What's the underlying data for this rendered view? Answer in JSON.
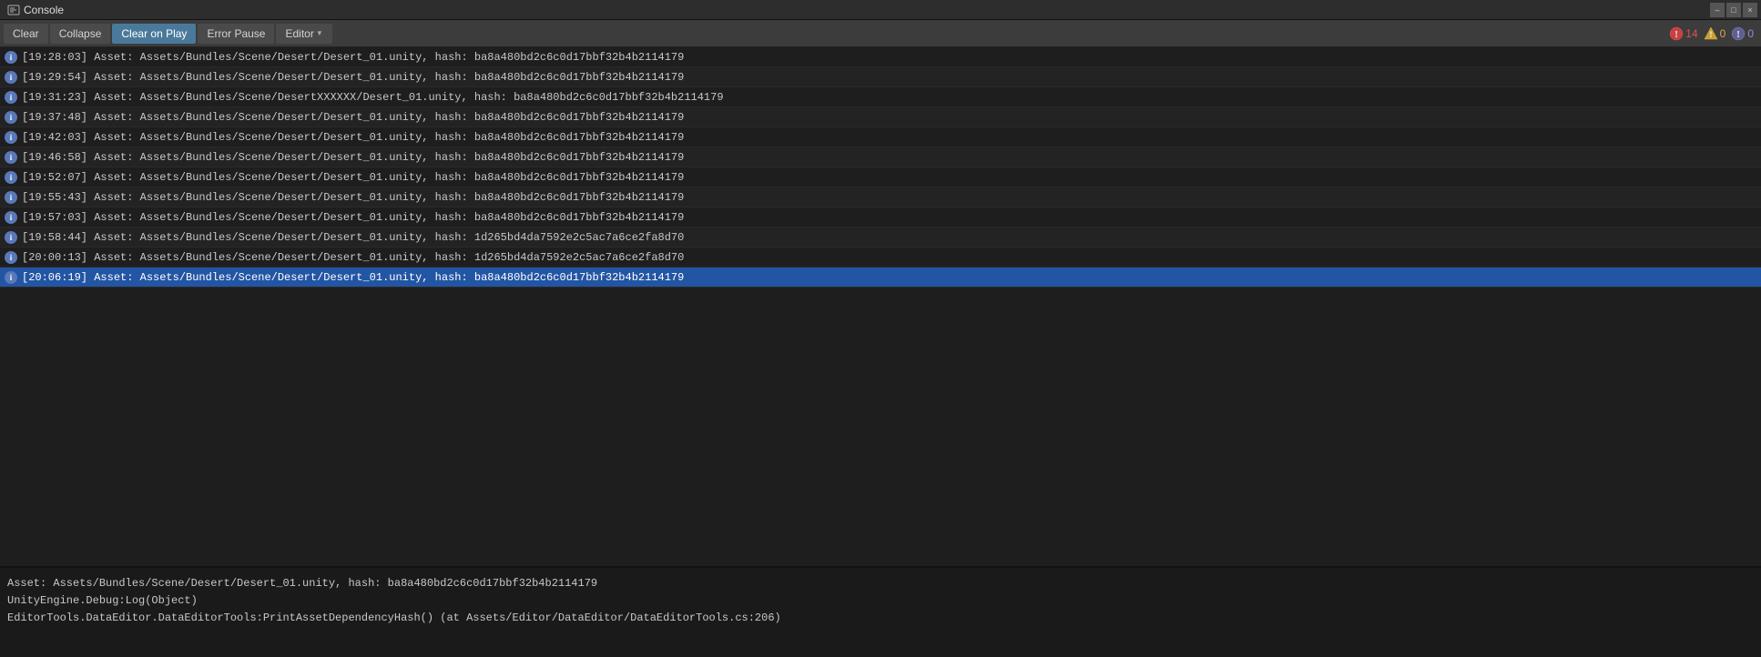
{
  "window": {
    "title": "Console",
    "icon": "console-icon"
  },
  "titlebar": {
    "controls": {
      "minimize": "–",
      "restore": "□",
      "close": "×"
    }
  },
  "toolbar": {
    "clear_label": "Clear",
    "collapse_label": "Collapse",
    "clear_on_play_label": "Clear on Play",
    "error_pause_label": "Error Pause",
    "editor_label": "Editor",
    "badge_errors_count": "14",
    "badge_warnings_count": "0",
    "badge_info_count": "0"
  },
  "log_rows": [
    {
      "time": "[19:28:03]",
      "message": "Asset: Assets/Bundles/Scene/Desert/Desert_01.unity, hash: ba8a480bd2c6c0d17bbf32b4b2114179",
      "selected": false
    },
    {
      "time": "[19:29:54]",
      "message": "Asset: Assets/Bundles/Scene/Desert/Desert_01.unity, hash: ba8a480bd2c6c0d17bbf32b4b2114179",
      "selected": false
    },
    {
      "time": "[19:31:23]",
      "message": "Asset: Assets/Bundles/Scene/DesertXXXXXX/Desert_01.unity, hash: ba8a480bd2c6c0d17bbf32b4b2114179",
      "selected": false
    },
    {
      "time": "[19:37:48]",
      "message": "Asset: Assets/Bundles/Scene/Desert/Desert_01.unity, hash: ba8a480bd2c6c0d17bbf32b4b2114179",
      "selected": false
    },
    {
      "time": "[19:42:03]",
      "message": "Asset: Assets/Bundles/Scene/Desert/Desert_01.unity, hash: ba8a480bd2c6c0d17bbf32b4b2114179",
      "selected": false
    },
    {
      "time": "[19:46:58]",
      "message": "Asset: Assets/Bundles/Scene/Desert/Desert_01.unity, hash: ba8a480bd2c6c0d17bbf32b4b2114179",
      "selected": false
    },
    {
      "time": "[19:52:07]",
      "message": "Asset: Assets/Bundles/Scene/Desert/Desert_01.unity, hash: ba8a480bd2c6c0d17bbf32b4b2114179",
      "selected": false
    },
    {
      "time": "[19:55:43]",
      "message": "Asset: Assets/Bundles/Scene/Desert/Desert_01.unity, hash: ba8a480bd2c6c0d17bbf32b4b2114179",
      "selected": false
    },
    {
      "time": "[19:57:03]",
      "message": "Asset: Assets/Bundles/Scene/Desert/Desert_01.unity, hash: ba8a480bd2c6c0d17bbf32b4b2114179",
      "selected": false
    },
    {
      "time": "[19:58:44]",
      "message": "Asset: Assets/Bundles/Scene/Desert/Desert_01.unity, hash: 1d265bd4da7592e2c5ac7a6ce2fa8d70",
      "selected": false
    },
    {
      "time": "[20:00:13]",
      "message": "Asset: Assets/Bundles/Scene/Desert/Desert_01.unity, hash: 1d265bd4da7592e2c5ac7a6ce2fa8d70",
      "selected": false
    },
    {
      "time": "[20:06:19]",
      "message": "Asset: Assets/Bundles/Scene/Desert/Desert_01.unity, hash: ba8a480bd2c6c0d17bbf32b4b2114179",
      "selected": true
    }
  ],
  "detail": {
    "line1": "Asset: Assets/Bundles/Scene/Desert/Desert_01.unity, hash: ba8a480bd2c6c0d17bbf32b4b2114179",
    "line2": "UnityEngine.Debug:Log(Object)",
    "line3": "EditorTools.DataEditor.DataEditorTools:PrintAssetDependencyHash() (at Assets/Editor/DataEditor/DataEditorTools.cs:206)"
  }
}
